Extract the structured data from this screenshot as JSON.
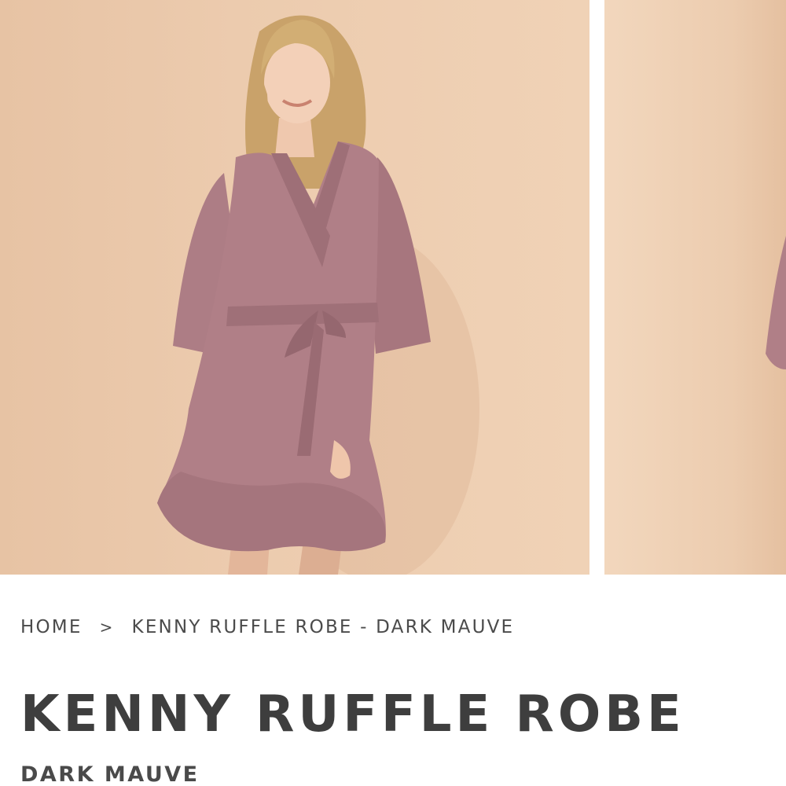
{
  "gallery": {
    "images": [
      {
        "alt": "Kenny Ruffle Robe - Dark Mauve, front view"
      },
      {
        "alt": "Kenny Ruffle Robe - Dark Mauve, alternate view"
      }
    ],
    "robe_color": "#b07f87",
    "background_color": "#ecccaf"
  },
  "breadcrumb": {
    "home": "HOME",
    "separator": ">",
    "current": "KENNY RUFFLE ROBE - DARK MAUVE"
  },
  "product": {
    "title": "KENNY RUFFLE ROBE",
    "color": "DARK MAUVE"
  }
}
